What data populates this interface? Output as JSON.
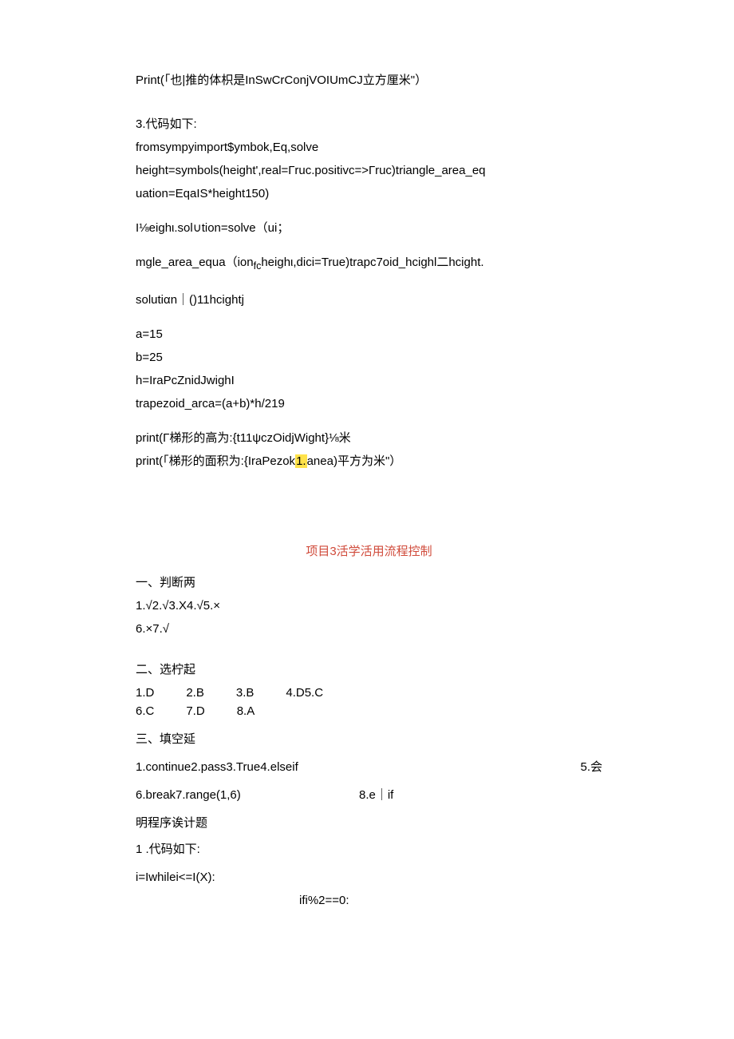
{
  "line1": "Print(「也|推的体枳是InSwCrConjVOIUmCJ立方厘米\"）",
  "sec3_title": "3.代码如下:",
  "sec3_l1": "fromsympyimport$ymbok,Eq,solve",
  "sec3_l2": "height=symbols(height',real=Гruc.positivc=>Гruc)triangle_area_eq",
  "sec3_l3": "uation=EqaIS*height150)",
  "sec3_l4": "I⅛eighι.sol∪tion=solve（ui；",
  "sec3_l5": "mgle_area_equa（ionfcheighι,dici=True)trapc7oid_hcighl二hcight.",
  "sec3_l6": "solutiαn｜()11hcightj",
  "sec3_l7": "a=15",
  "sec3_l8": "b=25",
  "sec3_l9": "h=IraPcZnidJwighI",
  "sec3_l10": "trapezoid_arca=(a+b)*h/219",
  "sec3_l11": "print(Γ梯形的高为:{t11ψczOidjWight}⅛米",
  "sec3_l12a": "print(「梯形的面积为:{IraPezok",
  "sec3_l12b": "1.",
  "sec3_l12c": "anea)平方为米\"）",
  "proj_title": "项目3活学活用流程控制",
  "judge_title": "一、判断两",
  "judge_l1": "1.√2.√3.X4.√5.×",
  "judge_l2": "6.×7.√",
  "choice_title": "二、选柠起",
  "choice_r1": {
    "c1": "1.D",
    "c2": "2.B",
    "c3": "3.B",
    "c4": "4.D5.C"
  },
  "choice_r2": {
    "c1": "6.C",
    "c2": "7.D",
    "c3": "8.A"
  },
  "fill_title": "三、填空延",
  "fill_r1_left": "1.continue2.pass3.True4.elseif",
  "fill_r1_right": "5.会",
  "fill_r2_left": "6.break7.range(1,6)",
  "fill_r2_mid": "8.e｜if",
  "prog_title": "明程序诶计题",
  "prog_l1": "1 .代码如下:",
  "prog_l2": "i=Iwhilei<=I(X):",
  "prog_l3": "ifi%2==0:"
}
